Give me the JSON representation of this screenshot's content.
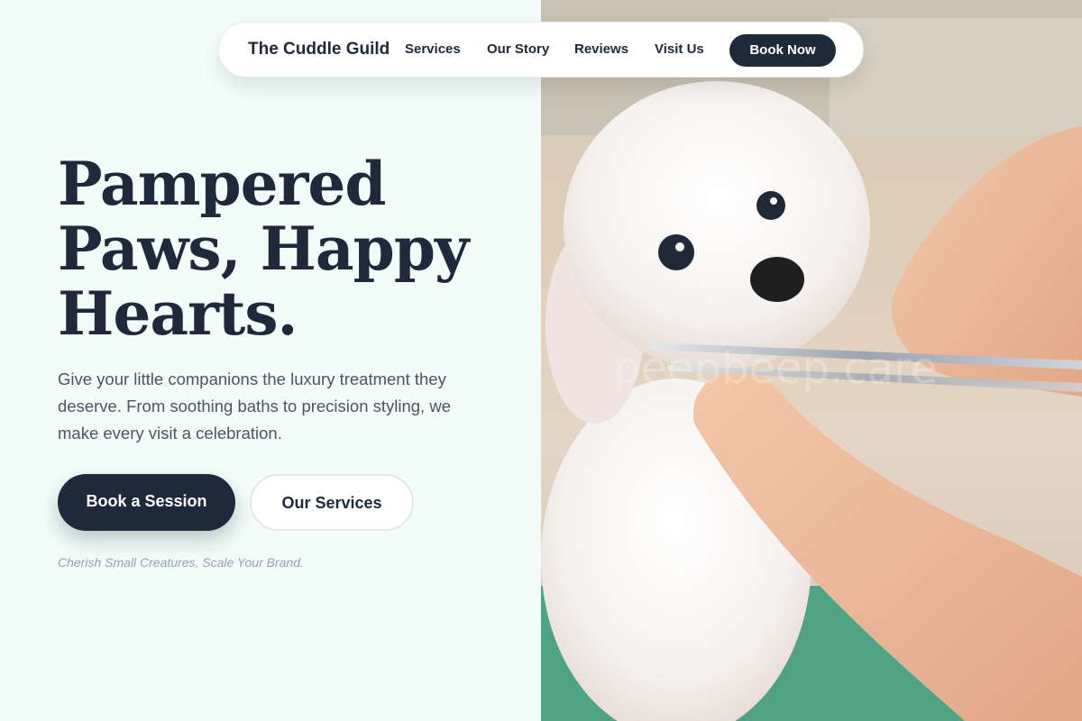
{
  "brand": "The Cuddle Guild",
  "nav": {
    "links": [
      "Services",
      "Our Story",
      "Reviews",
      "Visit Us"
    ],
    "cta": "Book Now"
  },
  "hero": {
    "headline": "Pampered Paws, Happy Hearts.",
    "subtitle": "Give your little companions the luxury treatment they deserve. From soothing baths to precision styling, we make every visit a celebration.",
    "primary_button": "Book a Session",
    "secondary_button": "Our Services",
    "tagline": "Cherish Small Creatures, Scale Your Brand."
  },
  "image": {
    "description_icon": "dog-grooming-photo",
    "watermark": "peepbeep.care"
  },
  "colors": {
    "primary": "#1e293b",
    "background": "#f2fcf8",
    "muted": "#94a3b8"
  }
}
